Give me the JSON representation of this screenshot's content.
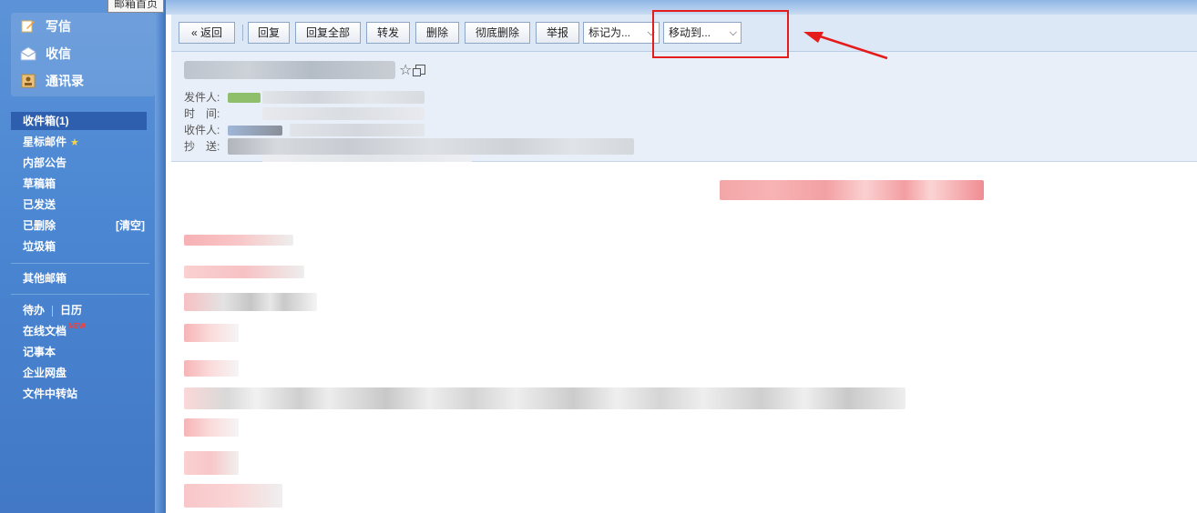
{
  "tooltip": "邮箱首页",
  "quick_actions": [
    {
      "label": "写信",
      "icon": "compose-icon"
    },
    {
      "label": "收信",
      "icon": "inbox-envelope-icon"
    },
    {
      "label": "通讯录",
      "icon": "contacts-icon"
    }
  ],
  "folders": [
    {
      "label": "收件箱(1)",
      "active": true
    },
    {
      "label": "星标邮件"
    },
    {
      "label": "内部公告"
    },
    {
      "label": "草稿箱"
    },
    {
      "label": "已发送"
    },
    {
      "label": "已删除",
      "action": "[清空]"
    },
    {
      "label": "垃圾箱"
    }
  ],
  "other_mailbox": "其他邮箱",
  "tools": {
    "todo": "待办",
    "calendar": "日历",
    "online_docs": "在线文档",
    "new_badge": "NEW",
    "notebook": "记事本",
    "netdisk": "企业网盘",
    "transfer": "文件中转站"
  },
  "toolbar": {
    "back": "« 返回",
    "reply": "回复",
    "reply_all": "回复全部",
    "forward": "转发",
    "delete": "删除",
    "delete_permanently": "彻底删除",
    "report": "举报",
    "mark_as": "标记为...",
    "move_to": "移动到..."
  },
  "header_labels": {
    "from": "发件人:",
    "time": "时　间:",
    "to": "收件人:",
    "cc": "抄　送:"
  },
  "colors": {
    "sidebar": "#4a86d2",
    "active_folder": "#2d5fae",
    "highlight": "#e51c1c",
    "toolbar_bg": "#dde8f6"
  }
}
